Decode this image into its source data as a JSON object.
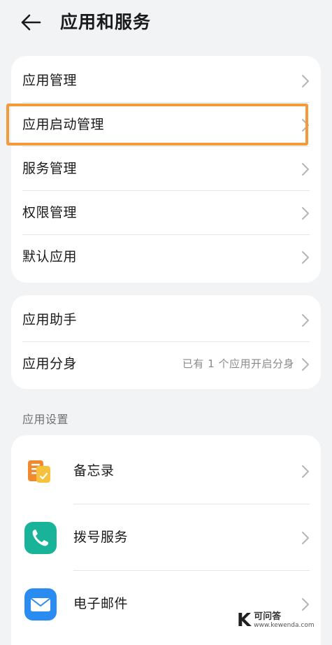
{
  "header": {
    "title": "应用和服务",
    "back_icon": "arrow-left-icon"
  },
  "group1": {
    "items": [
      {
        "label": "应用管理"
      },
      {
        "label": "应用启动管理",
        "highlighted": true
      },
      {
        "label": "服务管理"
      },
      {
        "label": "权限管理"
      },
      {
        "label": "默认应用"
      }
    ]
  },
  "group2": {
    "items": [
      {
        "label": "应用助手"
      },
      {
        "label": "应用分身",
        "value": "已有 1 个应用开启分身"
      }
    ]
  },
  "app_settings": {
    "section_title": "应用设置",
    "items": [
      {
        "label": "备忘录",
        "icon": "notes-icon",
        "color": "#f08a2e"
      },
      {
        "label": "拨号服务",
        "icon": "phone-icon",
        "color": "#19b39a"
      },
      {
        "label": "电子邮件",
        "icon": "email-icon",
        "color": "#2a8cf0"
      }
    ]
  },
  "colors": {
    "highlight": "#f39a3a",
    "background": "#f1f3f5",
    "card": "#ffffff"
  },
  "watermark": {
    "cn": "可问答",
    "en": "www.kewenda.com"
  }
}
